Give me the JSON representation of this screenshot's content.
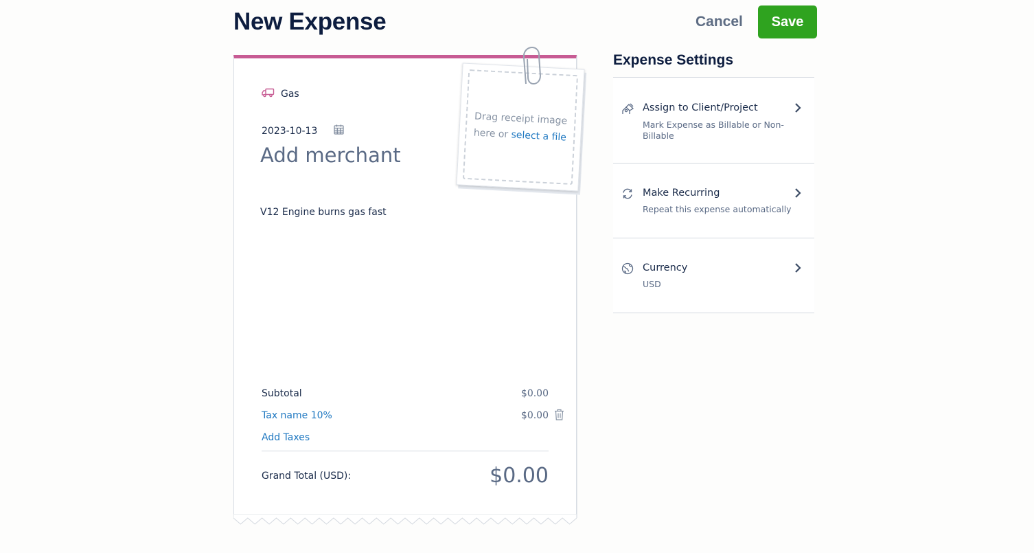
{
  "header": {
    "title": "New Expense",
    "cancel_label": "Cancel",
    "save_label": "Save"
  },
  "receipt": {
    "category": "Gas",
    "date": "2023-10-13",
    "merchant_placeholder": "Add merchant",
    "description": "V12 Engine burns gas fast",
    "attachment": {
      "prompt": "Drag receipt image here or",
      "link": "select a file"
    },
    "subtotal_label": "Subtotal",
    "subtotal_value": "$0.00",
    "tax_label": "Tax name 10%",
    "tax_value": "$0.00",
    "add_taxes_label": "Add Taxes",
    "grand_total_label": "Grand Total (USD):",
    "grand_total_value": "$0.00"
  },
  "settings": {
    "title": "Expense Settings",
    "items": [
      {
        "label": "Assign to Client/Project",
        "description": "Mark Expense as Billable or Non-Billable",
        "icon": "client-project-icon"
      },
      {
        "label": "Make Recurring",
        "description": "Repeat this expense automatically",
        "icon": "recurring-icon"
      },
      {
        "label": "Currency",
        "description": "USD",
        "icon": "currency-icon"
      }
    ]
  },
  "colors": {
    "accent": "#c75b93",
    "save": "#2fa31f",
    "link": "#1f78c1",
    "heading": "#0d1d3f"
  }
}
